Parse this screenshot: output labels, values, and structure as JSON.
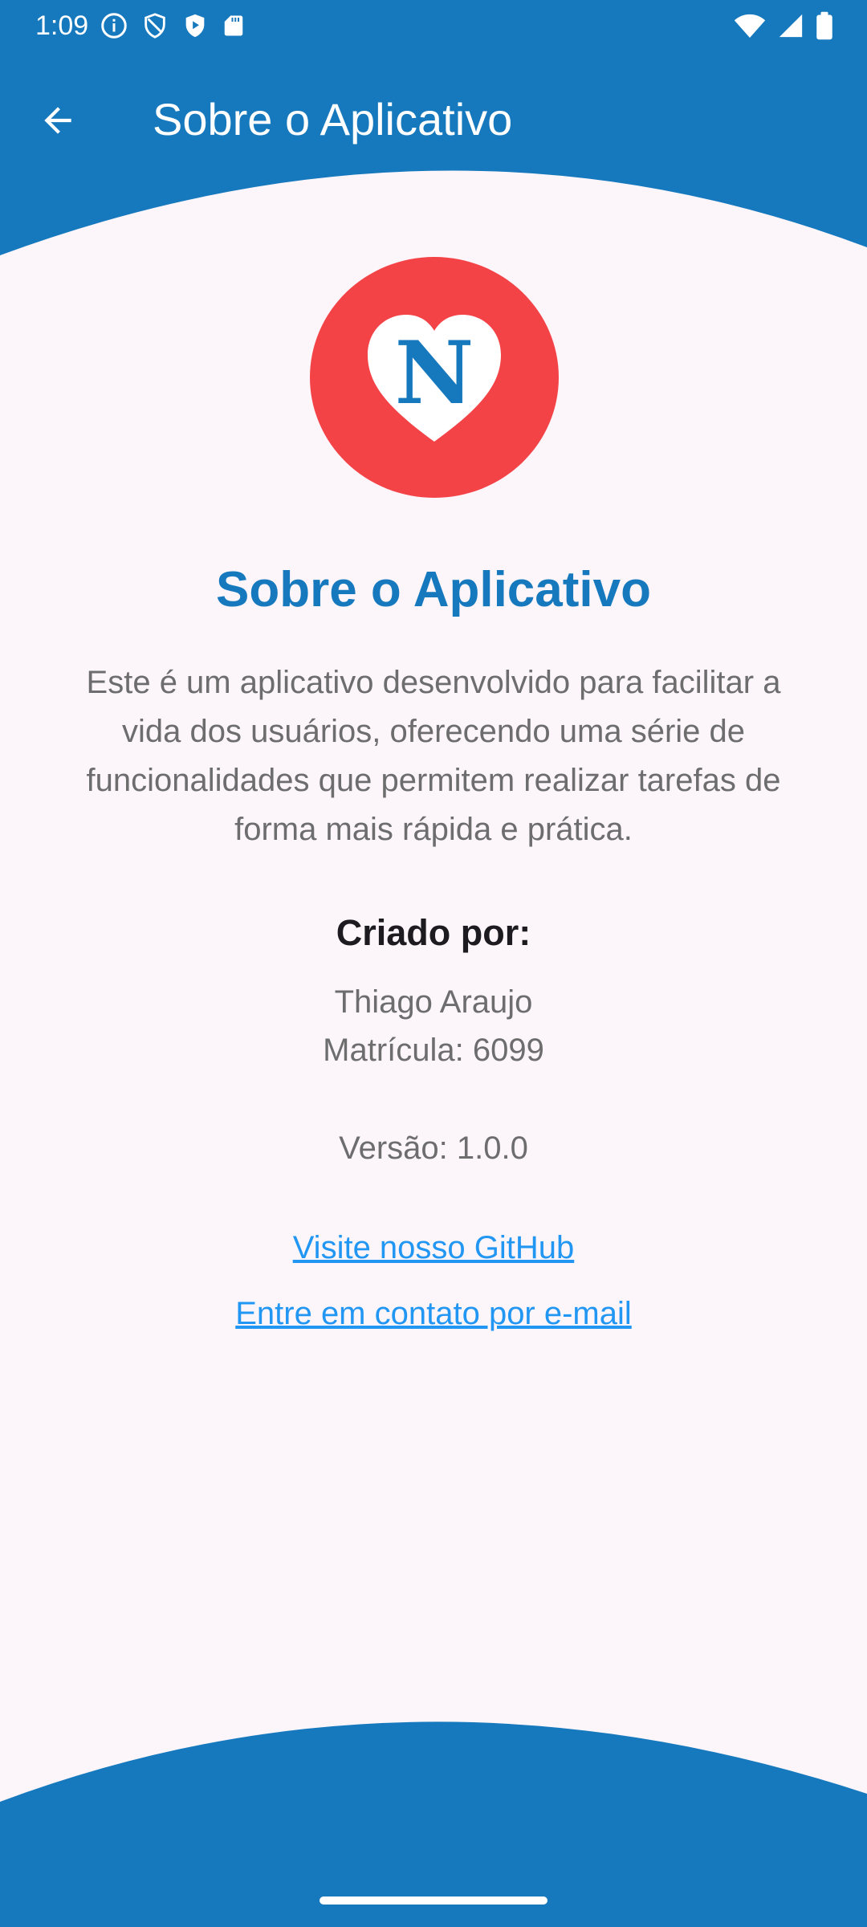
{
  "status_bar": {
    "time": "1:09",
    "left_icons": [
      "info-icon",
      "vpn-shield-icon",
      "play-protect-icon",
      "sd-card-icon"
    ],
    "right_icons": [
      "wifi-icon",
      "cellular-signal-icon",
      "battery-icon"
    ]
  },
  "app_bar": {
    "title": "Sobre o Aplicativo",
    "back_icon": "arrow-back-icon"
  },
  "logo": {
    "letter": "N",
    "shape": "heart-in-circle",
    "colors": {
      "circle": "#f44347",
      "heart": "#ffffff",
      "letter": "#1779bd"
    }
  },
  "main": {
    "title": "Sobre o Aplicativo",
    "description_lines": [
      "Este é um aplicativo desenvolvido para facilitar a",
      "vida dos usuários, oferecendo uma série de",
      "funcionalidades que permitem realizar tarefas de",
      "forma mais rápida e prática."
    ],
    "created_by_label": "Criado por:",
    "author_name": "Thiago Araujo",
    "author_id": "Matrícula: 6099",
    "version": "Versão: 1.0.0",
    "links": {
      "github": "Visite nosso GitHub",
      "email": "Entre em contato por e-mail"
    }
  },
  "colors": {
    "primary": "#1779bd",
    "background": "#fcf6fb",
    "body_text": "#6d6d6d",
    "heading_text": "#1d1b20",
    "link": "#2196f3"
  }
}
